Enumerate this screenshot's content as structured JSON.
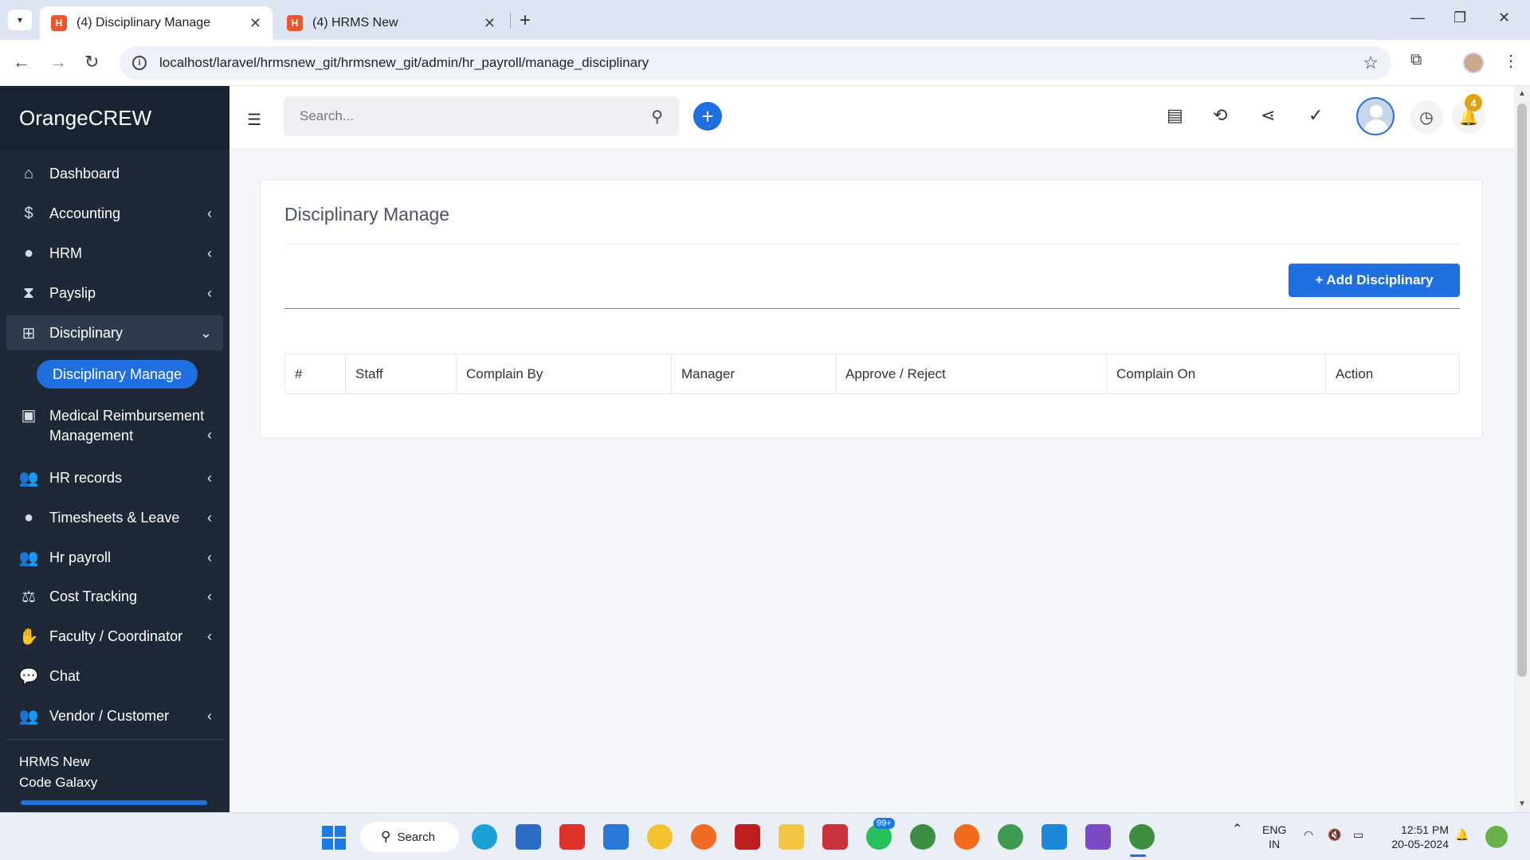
{
  "browser": {
    "tabs": [
      {
        "title": "(4) Disciplinary Manage",
        "active": true
      },
      {
        "title": "(4) HRMS New",
        "active": false
      }
    ],
    "url": "localhost/laravel/hrmsnew_git/hrmsnew_git/admin/hr_payroll/manage_disciplinary"
  },
  "sidebar": {
    "brand": "OrangeCREW",
    "items": [
      {
        "label": "Dashboard",
        "icon": "home-icon"
      },
      {
        "label": "Accounting",
        "icon": "dollar-icon"
      },
      {
        "label": "HRM",
        "icon": "user-circle-icon"
      },
      {
        "label": "Payslip",
        "icon": "hourglass-icon"
      },
      {
        "label": "Disciplinary",
        "icon": "sitemap-icon"
      },
      {
        "label": "Medical Reimbursement Management",
        "icon": "medical-kit-icon"
      },
      {
        "label": "HR records",
        "icon": "users-icon"
      },
      {
        "label": "Timesheets & Leave",
        "icon": "user-circle-icon"
      },
      {
        "label": "Hr payroll",
        "icon": "users-icon"
      },
      {
        "label": "Cost Tracking",
        "icon": "balance-scale-icon"
      },
      {
        "label": "Faculty / Coordinator",
        "icon": "handshake-icon"
      },
      {
        "label": "Chat",
        "icon": "chat-icon"
      },
      {
        "label": "Vendor / Customer",
        "icon": "users-icon"
      }
    ],
    "active_subitem": "Disciplinary Manage",
    "footer": {
      "line1": "HRMS New",
      "line2": "Code Galaxy"
    }
  },
  "header": {
    "search_placeholder": "Search...",
    "notification_count": "4"
  },
  "main": {
    "title": "Disciplinary Manage",
    "add_button": "+ Add Disciplinary",
    "table": {
      "columns": [
        "#",
        "Staff",
        "Complain By",
        "Manager",
        "Approve / Reject",
        "Complain On",
        "Action"
      ],
      "rows": []
    }
  },
  "taskbar": {
    "search_label": "Search",
    "whatsapp_badge": "99+",
    "language": "ENG",
    "region": "IN",
    "time": "12:51 PM",
    "date": "20-05-2024"
  },
  "colors": {
    "primary": "#1f6fe0",
    "sidebar_bg": "#1e2836",
    "divider_red": "#e05a5a",
    "badge": "#e2a20e"
  }
}
